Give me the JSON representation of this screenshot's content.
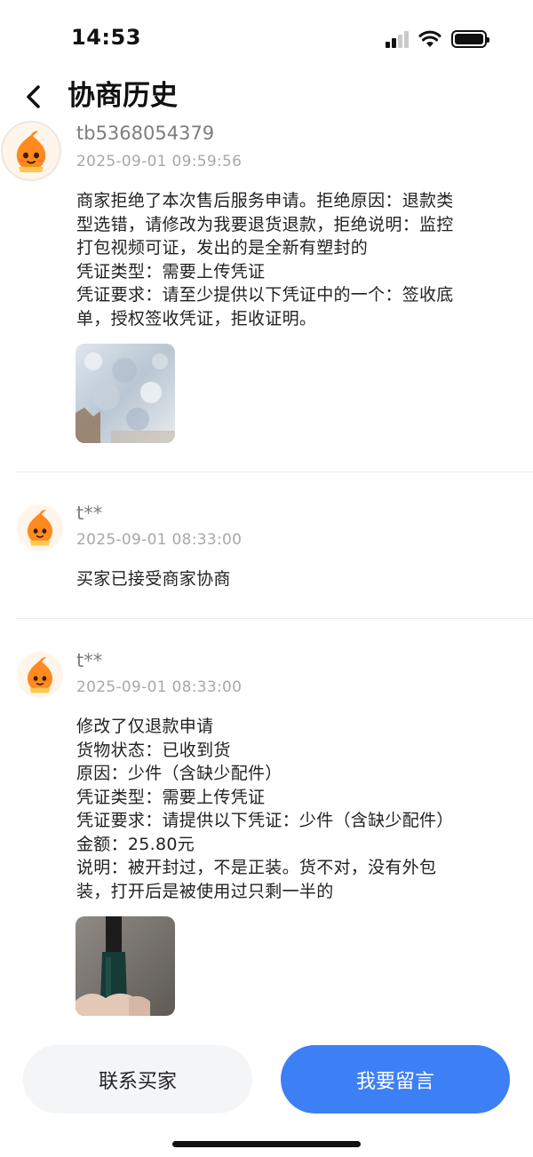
{
  "status_bar": {
    "time": "14:53"
  },
  "nav": {
    "title": "协商历史"
  },
  "records": [
    {
      "username": "tb5368054379",
      "time": "2025-09-01 09:59:56",
      "lines": [
        "商家拒绝了本次售后服务申请。拒绝原因：退款类",
        "型选错，请修改为我要退货退款，拒绝说明：监控",
        "打包视频可证，发出的是全新有塑封的",
        "凭证类型：需要上传凭证",
        "凭证要求：请至少提供以下凭证中的一个：签收底",
        "单，授权签收凭证，拒收证明。"
      ]
    },
    {
      "username": "t**",
      "time": "2025-09-01 08:33:00",
      "lines": [
        "买家已接受商家协商"
      ]
    },
    {
      "username": "t**",
      "time": "2025-09-01 08:33:00",
      "lines": [
        "修改了仅退款申请",
        "货物状态：已收到货",
        "原因：少件（含缺少配件）",
        "凭证类型：需要上传凭证",
        "凭证要求：请提供以下凭证：少件（含缺少配件）",
        "金额：25.80元",
        "说明：被开封过，不是正装。货不对，没有外包",
        "装，打开后是被使用过只剩一半的"
      ]
    }
  ],
  "buttons": {
    "contact_buyer": "联系买家",
    "leave_message": "我要留言"
  },
  "colors": {
    "primary": "#3d7ff5",
    "mascot": "#ff8a1f"
  }
}
